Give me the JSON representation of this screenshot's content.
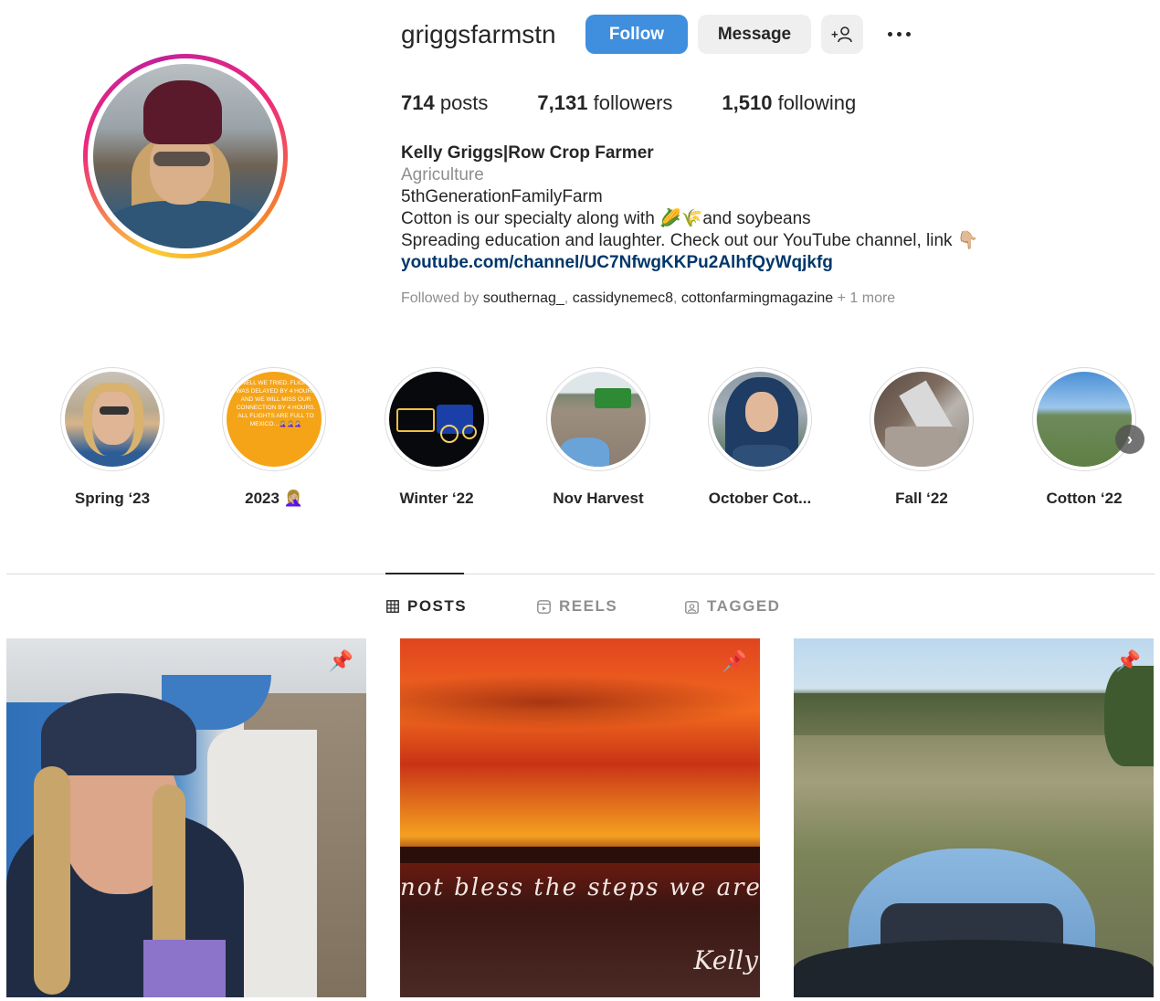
{
  "profile": {
    "username": "griggsfarmstn",
    "follow_label": "Follow",
    "message_label": "Message",
    "add_user_icon": "+👤",
    "stats": {
      "posts_count": "714",
      "posts_label": " posts",
      "followers_count": "7,131",
      "followers_label": " followers",
      "following_count": "1,510",
      "following_label": " following"
    },
    "bio": {
      "name": "Kelly Griggs|Row Crop Farmer",
      "category": "Agriculture",
      "line1": "5thGenerationFamilyFarm",
      "line2": "Cotton is our specialty along with 🌽🌾and soybeans",
      "line3": "Spreading education and laughter. Check out our YouTube channel, link 👇🏼",
      "link": "youtube.com/channel/UC7NfwgKKPu2AlhfQyWqjkfg"
    },
    "followed_by": {
      "prefix": "Followed by ",
      "users": [
        "southernag_",
        "cassidynemec8",
        "cottonfarmingmagazine"
      ],
      "more": " + 1 more"
    }
  },
  "highlights": [
    {
      "label": "Spring ‘23"
    },
    {
      "label": "2023 🤦🏼‍♀️",
      "overlay_text": "WELL WE TRIED. FLIGHT WAS DELAYED BY 4 HOURS AND WE WILL MISS OUR CONNECTION BY 4 HOURS. ALL FLIGHTS ARE FULL TO MEXICO…🤦🏼‍♀️🤦🏼‍♀️🤦🏼‍♀️"
    },
    {
      "label": "Winter ‘22"
    },
    {
      "label": "Nov Harvest"
    },
    {
      "label": "October Cot..."
    },
    {
      "label": "Fall ‘22"
    },
    {
      "label": "Cotton ‘22"
    }
  ],
  "tabs": [
    {
      "label": "POSTS",
      "icon": "grid-icon",
      "active": true
    },
    {
      "label": "REELS",
      "icon": "reels-icon",
      "active": false
    },
    {
      "label": "TAGGED",
      "icon": "tagged-icon",
      "active": false
    }
  ],
  "posts": [
    {
      "pinned": true
    },
    {
      "pinned": true,
      "caption": "not bless the steps we are not willing",
      "signature": "Kelly"
    },
    {
      "pinned": true
    }
  ],
  "colors": {
    "follow_button": "#3f8fde",
    "link": "#00376b",
    "muted": "#8e8e8e"
  }
}
